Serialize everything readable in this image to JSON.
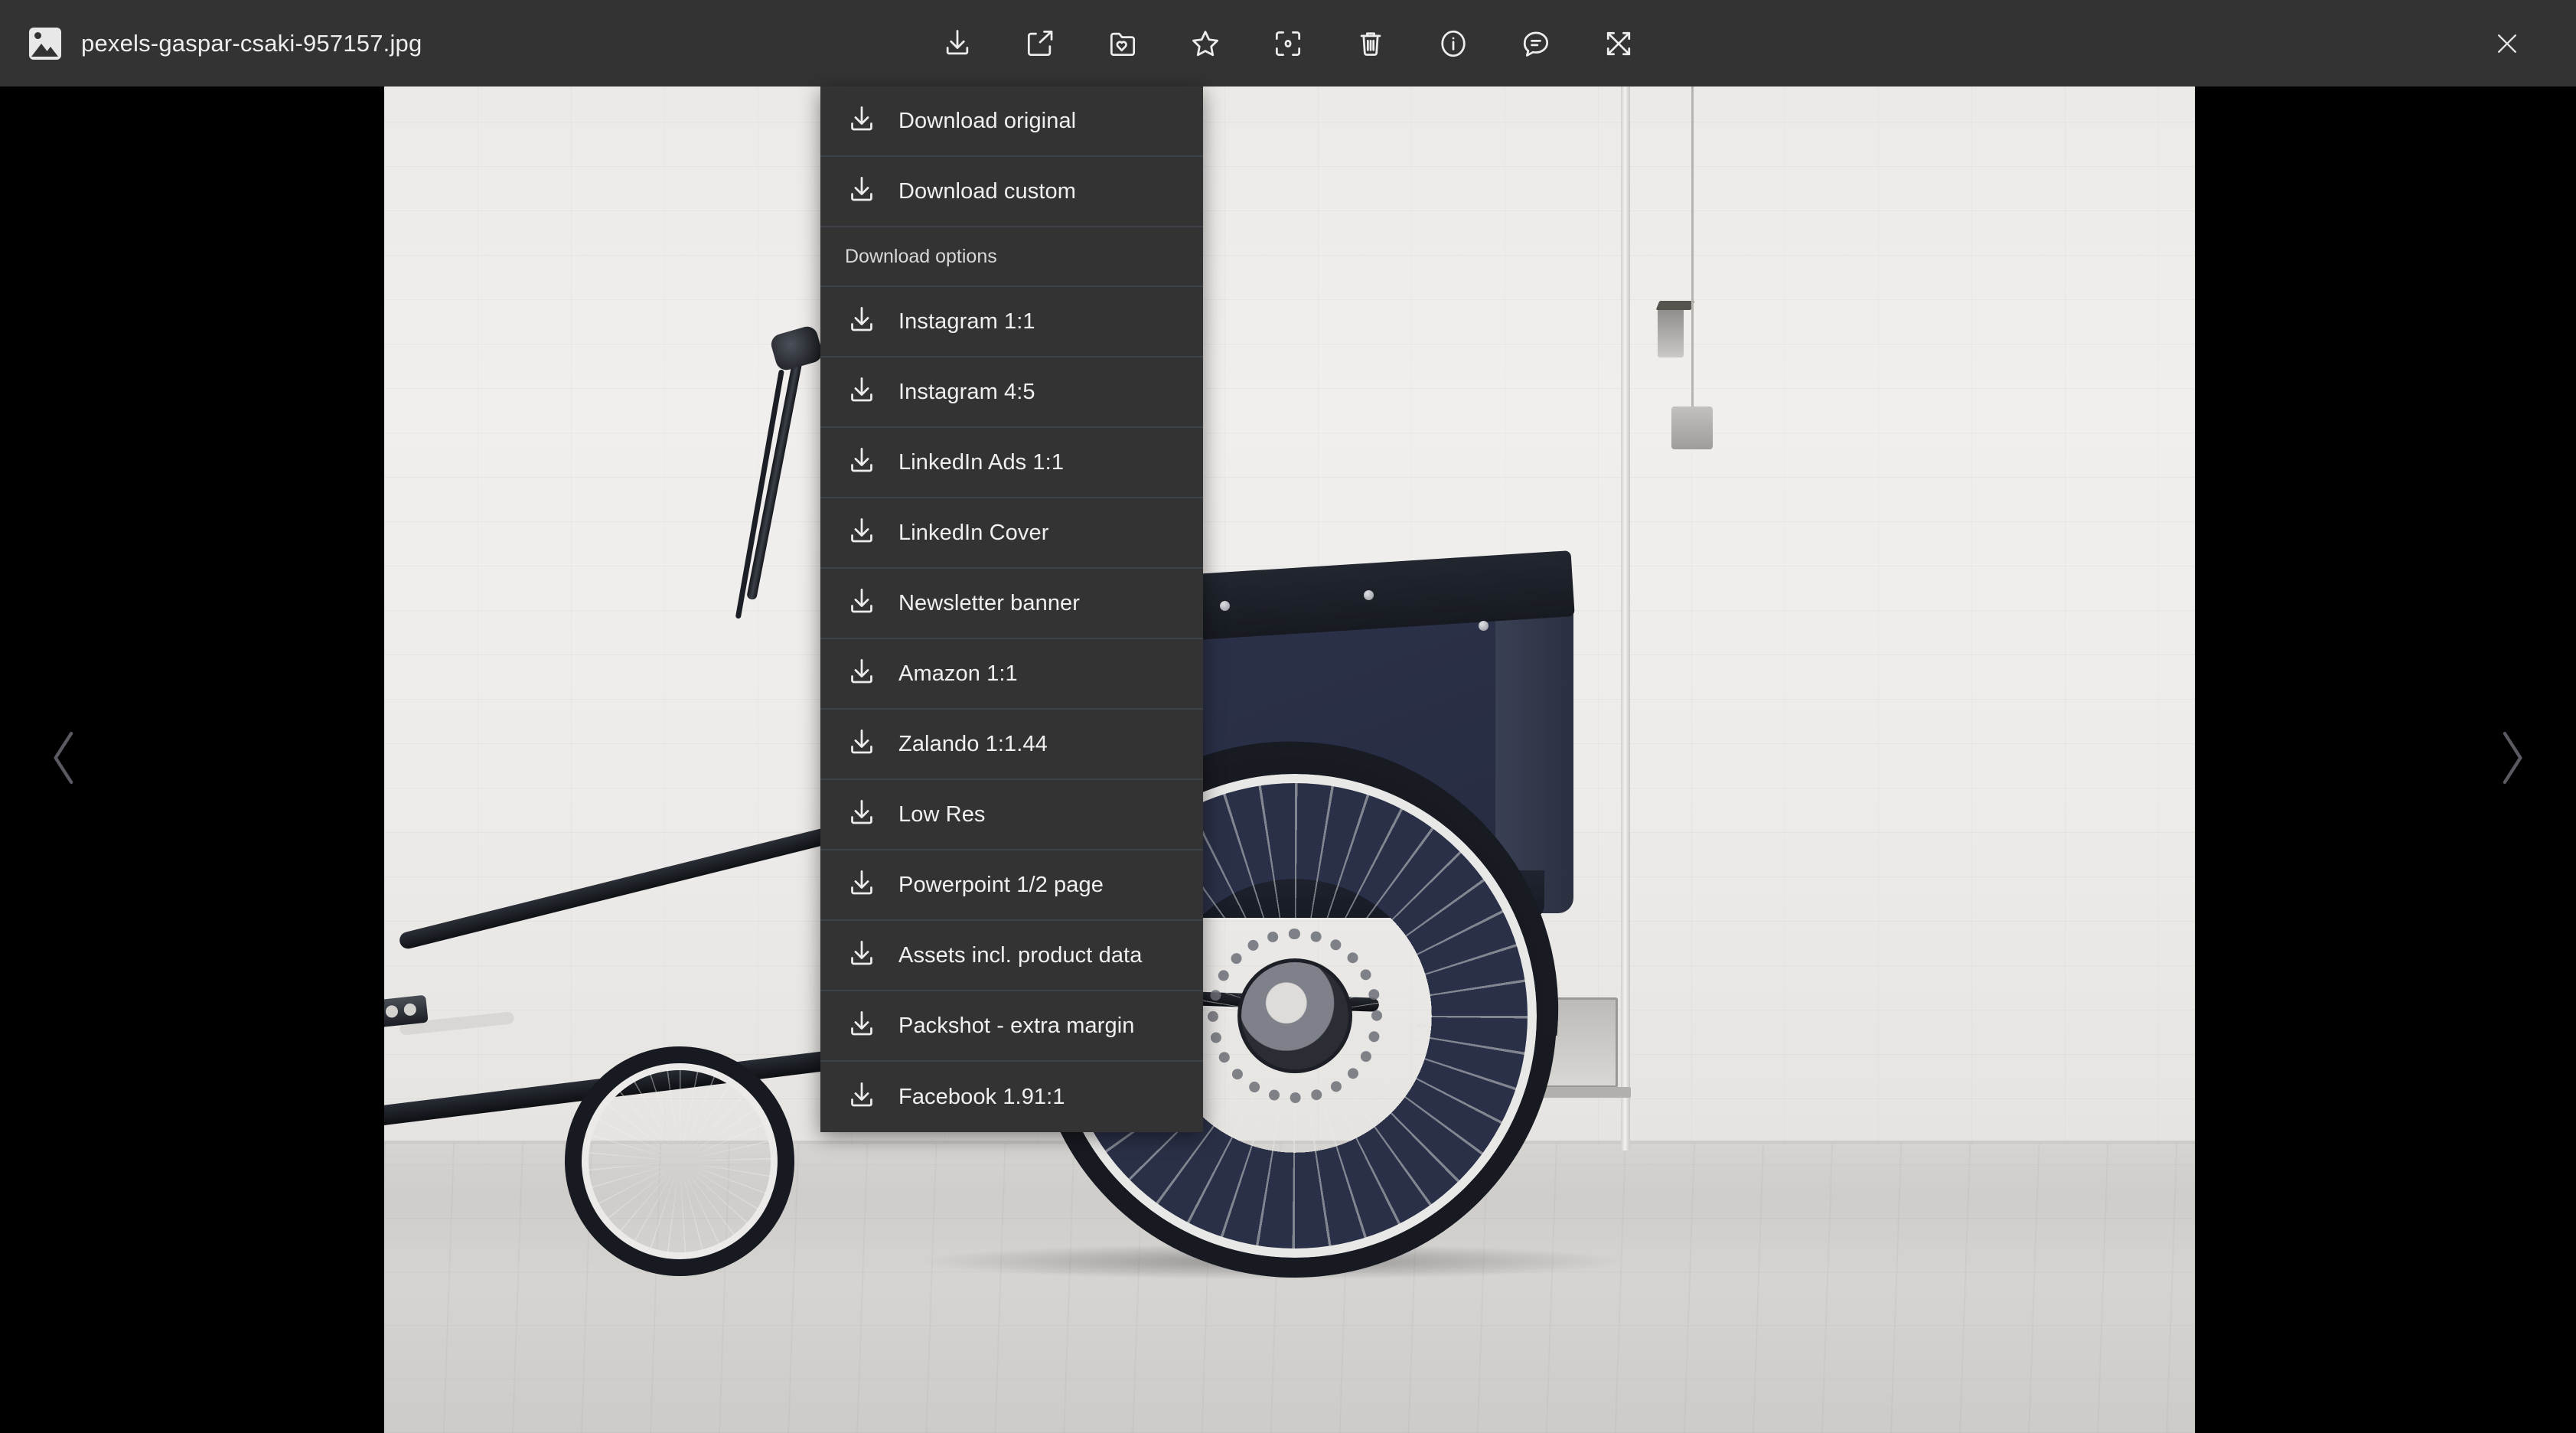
{
  "window": {
    "file_icon": "image-file-icon",
    "title": "pexels-gaspar-csaki-957157.jpg",
    "close_label": "close-icon"
  },
  "toolbar": {
    "items": [
      {
        "name": "download-icon",
        "tooltip": "Download"
      },
      {
        "name": "share-icon",
        "tooltip": "Share"
      },
      {
        "name": "collection-icon",
        "tooltip": "Add to collection"
      },
      {
        "name": "star-icon",
        "tooltip": "Favorite"
      },
      {
        "name": "crop-focus-icon",
        "tooltip": "Focus point"
      },
      {
        "name": "trash-icon",
        "tooltip": "Delete"
      },
      {
        "name": "info-icon",
        "tooltip": "Info"
      },
      {
        "name": "comment-icon",
        "tooltip": "Comments"
      },
      {
        "name": "fullscreen-icon",
        "tooltip": "Fullscreen"
      }
    ]
  },
  "navigation": {
    "prev_icon": "chevron-left-icon",
    "next_icon": "chevron-right-icon"
  },
  "download_menu": {
    "primary": [
      {
        "icon": "download-icon",
        "label": "Download original"
      },
      {
        "icon": "download-icon",
        "label": "Download custom"
      }
    ],
    "section_label": "Download options",
    "options": [
      {
        "icon": "download-icon",
        "label": "Instagram 1:1"
      },
      {
        "icon": "download-icon",
        "label": "Instagram 4:5"
      },
      {
        "icon": "download-icon",
        "label": "LinkedIn Ads 1:1"
      },
      {
        "icon": "download-icon",
        "label": "LinkedIn Cover"
      },
      {
        "icon": "download-icon",
        "label": "Newsletter banner"
      },
      {
        "icon": "download-icon",
        "label": "Amazon 1:1"
      },
      {
        "icon": "download-icon",
        "label": "Zalando 1:1.44"
      },
      {
        "icon": "download-icon",
        "label": "Low Res"
      },
      {
        "icon": "download-icon",
        "label": "Powerpoint 1/2 page"
      },
      {
        "icon": "download-icon",
        "label": "Assets incl. product data"
      },
      {
        "icon": "download-icon",
        "label": "Packshot - extra margin"
      },
      {
        "icon": "download-icon",
        "label": "Facebook 1.91:1"
      }
    ]
  },
  "preview": {
    "alt": "Dark navy cargo trike (bakfiets) parked in front of a white painted brick wall on a grey concrete floor"
  },
  "colors": {
    "chrome": "#333333",
    "backdrop": "#000000",
    "menu_divider": "#3d4248",
    "text": "#f0f0f0",
    "muted_text": "#d8d8d8",
    "arrow": "#5a5b62"
  }
}
